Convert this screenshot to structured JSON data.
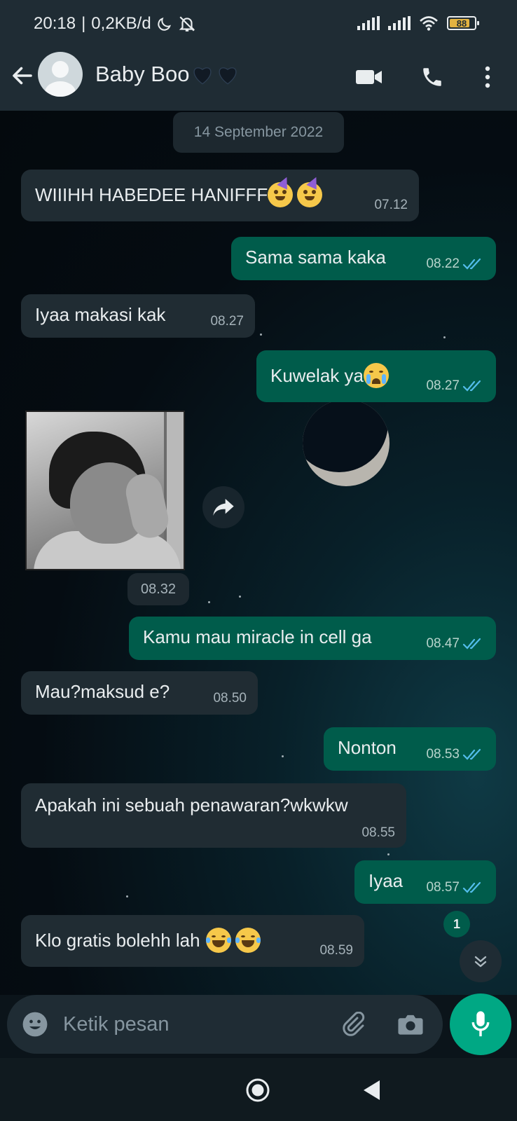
{
  "status_bar": {
    "time": "20:18",
    "separator": "|",
    "speed": "0,2KB/d",
    "battery": "88"
  },
  "header": {
    "contact_name": "Baby Boo",
    "name_emojis": "🖤🖤"
  },
  "chat": {
    "date_chip": "14 September 2022",
    "messages": [
      {
        "dir": "in",
        "text": "WIIIHH HABEDEE HANIFFF",
        "emoji": "🥳🥳",
        "time": "07.12"
      },
      {
        "dir": "out",
        "text": "Sama sama kaka",
        "time": "08.22",
        "read": true
      },
      {
        "dir": "in",
        "text": "Iyaa makasi kak",
        "time": "08.27"
      },
      {
        "dir": "out",
        "text": "Kuwelak ya",
        "emoji": "😭",
        "time": "08.27",
        "read": true
      },
      {
        "dir": "in",
        "type": "sticker",
        "time": "08.32"
      },
      {
        "dir": "out",
        "text": "Kamu mau miracle in cell ga",
        "time": "08.47",
        "read": true
      },
      {
        "dir": "in",
        "text": "Mau?maksud e?",
        "time": "08.50"
      },
      {
        "dir": "out",
        "text": "Nonton",
        "time": "08.53",
        "read": true
      },
      {
        "dir": "in",
        "text": "Apakah ini sebuah penawaran?wkwkw",
        "time": "08.55"
      },
      {
        "dir": "out",
        "text": "Iyaa",
        "time": "08.57",
        "read": true
      },
      {
        "dir": "in",
        "text": "Klo gratis bolehh lah",
        "emoji": "😂😂",
        "time": "08.59"
      }
    ],
    "unread_count": "1"
  },
  "input": {
    "placeholder": "Ketik pesan"
  },
  "colors": {
    "incoming_bubble": "#202c33",
    "outgoing_bubble": "#005c4b",
    "accent": "#00a884",
    "read_tick": "#53bdeb",
    "header_bg": "#1f2c34"
  },
  "icons": [
    "back-arrow-icon",
    "video-call-icon",
    "phone-icon",
    "more-options-icon",
    "forward-icon",
    "chevron-double-down-icon",
    "emoji-icon",
    "attach-icon",
    "camera-icon",
    "mic-icon",
    "home-icon",
    "back-nav-icon",
    "moon-icon",
    "dnd-bell-icon",
    "signal-icon",
    "wifi-icon",
    "battery-icon"
  ]
}
